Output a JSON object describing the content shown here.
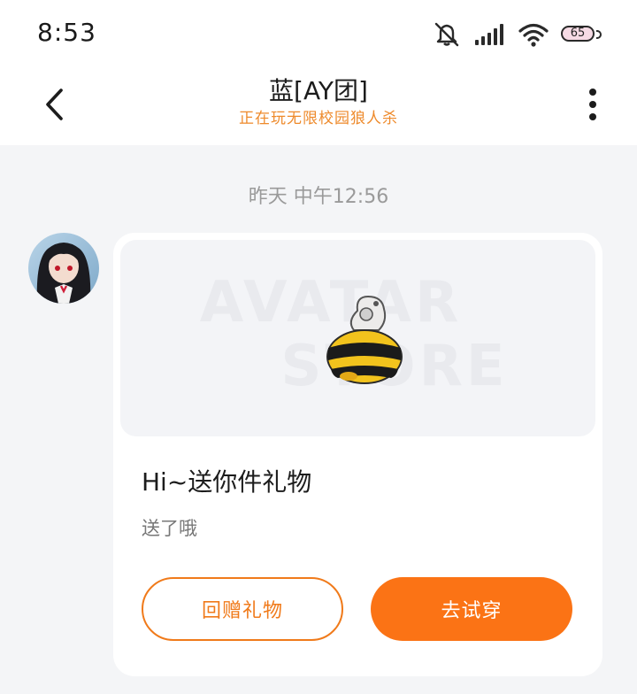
{
  "status_bar": {
    "time": "8:53",
    "battery_level": "65",
    "icons": [
      "mute-icon",
      "signal-icon",
      "wifi-icon",
      "battery-icon"
    ]
  },
  "header": {
    "title": "蓝[AY团]",
    "subtitle": "正在玩无限校园狼人杀",
    "back_icon": "chevron-left-icon",
    "more_icon": "vertical-dots-icon"
  },
  "chat": {
    "timestamp": "昨天 中午12:56",
    "message": {
      "avatar_icon": "avatar",
      "gift_watermark": "AVATAR STORE",
      "gift_icon": "gift-item-icon",
      "title": "Hi~送你件礼物",
      "description": "送了哦",
      "actions": {
        "return_gift_label": "回赠礼物",
        "try_on_label": "去试穿"
      }
    }
  },
  "colors": {
    "accent": "#fb7315",
    "subtitle": "#ee8a2b",
    "background": "#f4f5f7",
    "card": "#ffffff"
  }
}
